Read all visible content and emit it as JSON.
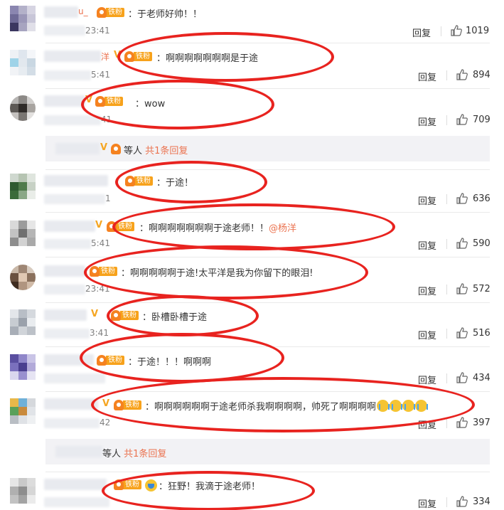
{
  "comments": [
    {
      "name_frag": "u_",
      "text": "：于老师好帅！！",
      "time": "23:41",
      "reply": "回复",
      "likes": "1019"
    },
    {
      "name_frag": "洋",
      "text": "：啊啊啊啊啊啊啊是于途",
      "time": "5:41",
      "reply": "回复",
      "likes": "894"
    },
    {
      "name_frag": "",
      "text": "：wow",
      "time": "41",
      "reply": "回复",
      "likes": "709"
    },
    {
      "name_frag": "",
      "text": "：于途！",
      "time": "1",
      "reply": "回复",
      "likes": "636"
    },
    {
      "name_frag": "",
      "text": "：啊啊啊啊啊啊啊于途老师！！",
      "mention": "@杨洋",
      "time": "5:41",
      "reply": "回复",
      "likes": "590"
    },
    {
      "name_frag": "",
      "text": "：啊啊啊啊啊于途!太平洋是我为你留下的眼泪!",
      "time": "23:41",
      "reply": "回复",
      "likes": "572"
    },
    {
      "name_frag": "",
      "text": "：卧槽卧槽于途",
      "time": "3:41",
      "reply": "回复",
      "likes": "516"
    },
    {
      "name_frag": "",
      "text": "：于途！！！啊啊啊",
      "time": "",
      "reply": "回复",
      "likes": "434"
    },
    {
      "name_frag": "",
      "text": "：啊啊啊啊啊啊于途老师杀我啊啊啊啊，帅死了啊啊啊啊",
      "time": "42",
      "reply": "回复",
      "likes": "397"
    },
    {
      "name_frag": "",
      "text": "狂野！我滴于途老师！",
      "time": "",
      "reply": "回复",
      "likes": "334"
    }
  ],
  "fan_badge": "铁粉",
  "sub_replies": [
    {
      "others": "等人",
      "link": "共1条回复"
    },
    {
      "others": "等人",
      "link": "共1条回复"
    }
  ]
}
